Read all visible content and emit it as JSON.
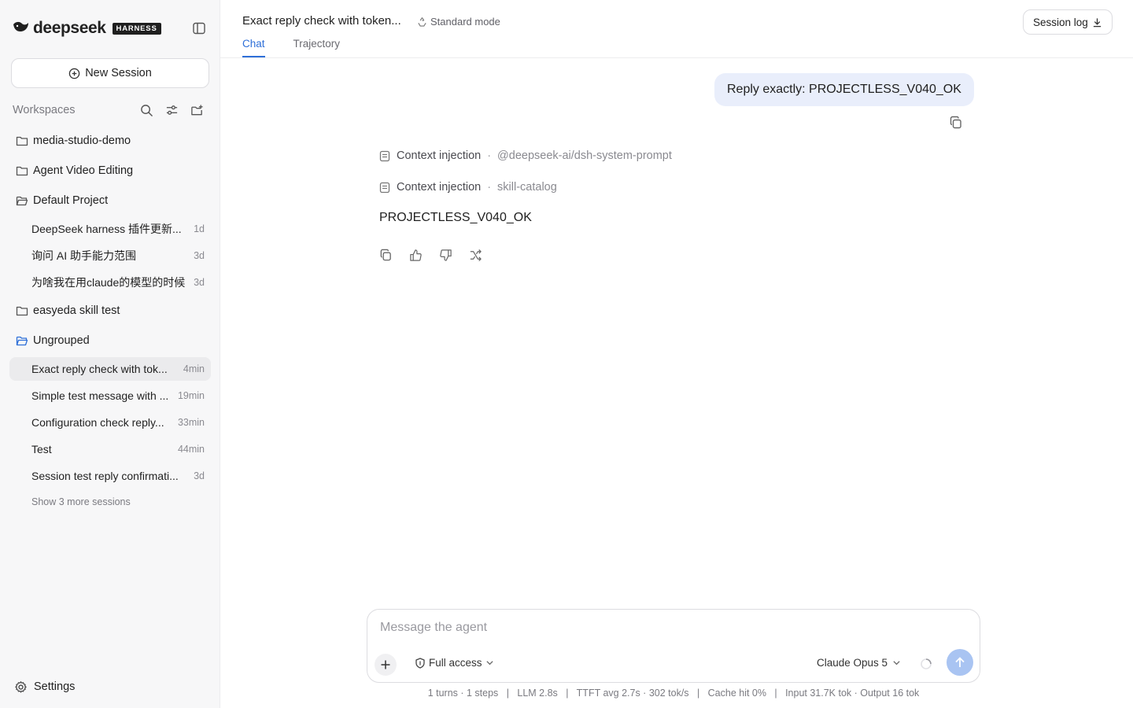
{
  "brand": {
    "name": "deepseek",
    "badge": "HARNESS"
  },
  "sidebar": {
    "new_session_label": "New Session",
    "workspaces_label": "Workspaces",
    "settings_label": "Settings",
    "folders": [
      {
        "name": "media-studio-demo"
      },
      {
        "name": "Agent Video Editing"
      },
      {
        "name": "Default Project",
        "sessions": [
          {
            "title": "DeepSeek harness 插件更新...",
            "time": "1d"
          },
          {
            "title": "询问 AI 助手能力范围",
            "time": "3d"
          },
          {
            "title": "为啥我在用claude的模型的时候",
            "time": "3d"
          }
        ]
      },
      {
        "name": "easyeda skill test"
      },
      {
        "name": "Ungrouped",
        "sessions": [
          {
            "title": "Exact reply check with tok...",
            "time": "4min"
          },
          {
            "title": "Simple test message with ...",
            "time": "19min"
          },
          {
            "title": "Configuration check reply...",
            "time": "33min"
          },
          {
            "title": "Test",
            "time": "44min"
          },
          {
            "title": "Session test reply confirmati...",
            "time": "3d"
          }
        ]
      }
    ],
    "show_more": "Show 3 more sessions"
  },
  "header": {
    "title": "Exact reply check with token...",
    "mode": "Standard mode",
    "tabs": [
      "Chat",
      "Trajectory"
    ],
    "session_log": "Session log"
  },
  "chat": {
    "user_message": "Reply exactly: PROJECTLESS_V040_OK",
    "context": [
      {
        "label": "Context injection",
        "source": "@deepseek-ai/dsh-system-prompt"
      },
      {
        "label": "Context injection",
        "source": "skill-catalog"
      }
    ],
    "reply": "PROJECTLESS_V040_OK",
    "separator": "·"
  },
  "composer": {
    "placeholder": "Message the agent",
    "access": "Full access",
    "model": "Claude Opus 5"
  },
  "stats": "1 turns · 1 steps   |   LLM 2.8s   |   TTFT avg 2.7s · 302 tok/s   |   Cache hit 0%   |   Input 31.7K tok · Output 16 tok",
  "colors": {
    "accent": "#2e6fd8",
    "user_bubble": "#e9eefb",
    "send_button": "#a9c4f2",
    "active_row": "#ebebed"
  }
}
